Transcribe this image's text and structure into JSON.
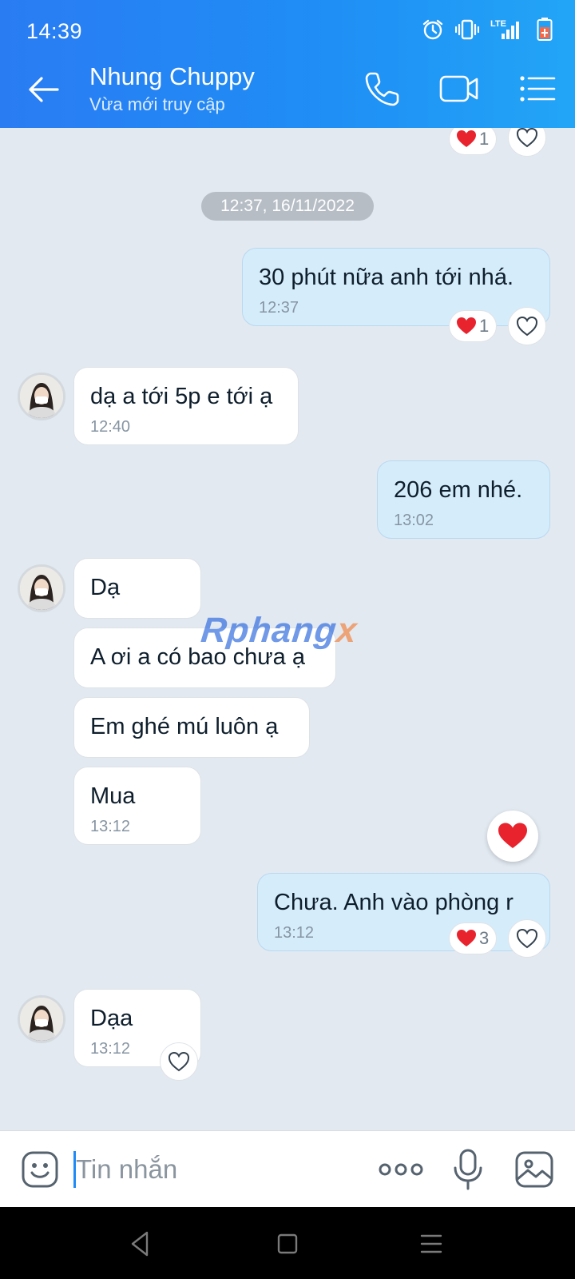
{
  "status_bar": {
    "time": "14:39",
    "network_label": "LTE"
  },
  "header": {
    "contact_name": "Nhung Chuppy",
    "contact_status": "Vừa mới truy cập"
  },
  "date_separator": "12:37, 16/11/2022",
  "messages": [
    {
      "direction": "out",
      "text": "30 phút nữa anh tới nhá.",
      "time": "12:37",
      "reaction_count": "1"
    },
    {
      "direction": "in",
      "text": "dạ a tới 5p e tới ạ",
      "time": "12:40"
    },
    {
      "direction": "out",
      "text": "206 em nhé.",
      "time": "13:02"
    },
    {
      "direction": "in",
      "text": "Dạ"
    },
    {
      "direction": "in",
      "text": "A ơi a có bao chưa ạ"
    },
    {
      "direction": "in",
      "text": "Em ghé mú luôn ạ"
    },
    {
      "direction": "in",
      "text": "Mua",
      "time": "13:12"
    },
    {
      "direction": "out",
      "text": "Chưa. Anh vào phòng r",
      "time": "13:12",
      "reaction_count": "3"
    },
    {
      "direction": "in",
      "text": "Dạa",
      "time": "13:12"
    }
  ],
  "partial_top_reaction_count": "1",
  "watermark": {
    "main": "Rphang",
    "accent": "x"
  },
  "input": {
    "placeholder": "Tin nhắn"
  },
  "colors": {
    "header_start": "#2a7cf3",
    "header_end": "#22a5f7",
    "outgoing_bubble": "#d5ecfb",
    "incoming_bubble": "#ffffff",
    "chat_background": "#e2e9f1",
    "heart": "#e8232e"
  }
}
